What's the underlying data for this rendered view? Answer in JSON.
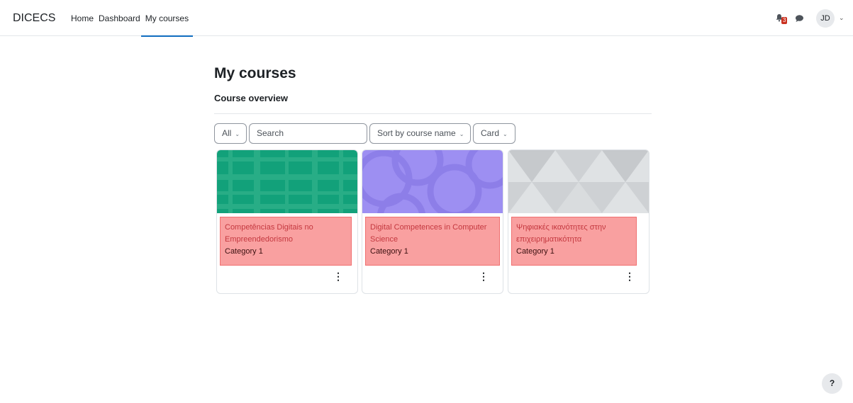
{
  "navbar": {
    "brand": "DICECS",
    "items": [
      {
        "label": "Home"
      },
      {
        "label": "Dashboard"
      },
      {
        "label": "My courses"
      }
    ],
    "notification_count": "3",
    "user_initials": "JD"
  },
  "page": {
    "title": "My courses",
    "section_title": "Course overview"
  },
  "filters": {
    "grouping": "All",
    "search_placeholder": "Search",
    "sort": "Sort by course name",
    "view": "Card"
  },
  "courses": [
    {
      "name": "Competências Digitais no Empreendedorismo",
      "category": "Category 1",
      "image_color": "#12a17a"
    },
    {
      "name": "Digital Competences in Computer Science",
      "category": "Category 1",
      "image_color": "#9d8ff2"
    },
    {
      "name": "Ψηφιακές ικανότητες στην επιχειρηματικότητα",
      "category": "Category 1",
      "image_color": "#ced1d4"
    }
  ],
  "help": {
    "label": "?"
  },
  "colors": {
    "accent": "#0f6cbf",
    "badge": "#ca3120"
  }
}
